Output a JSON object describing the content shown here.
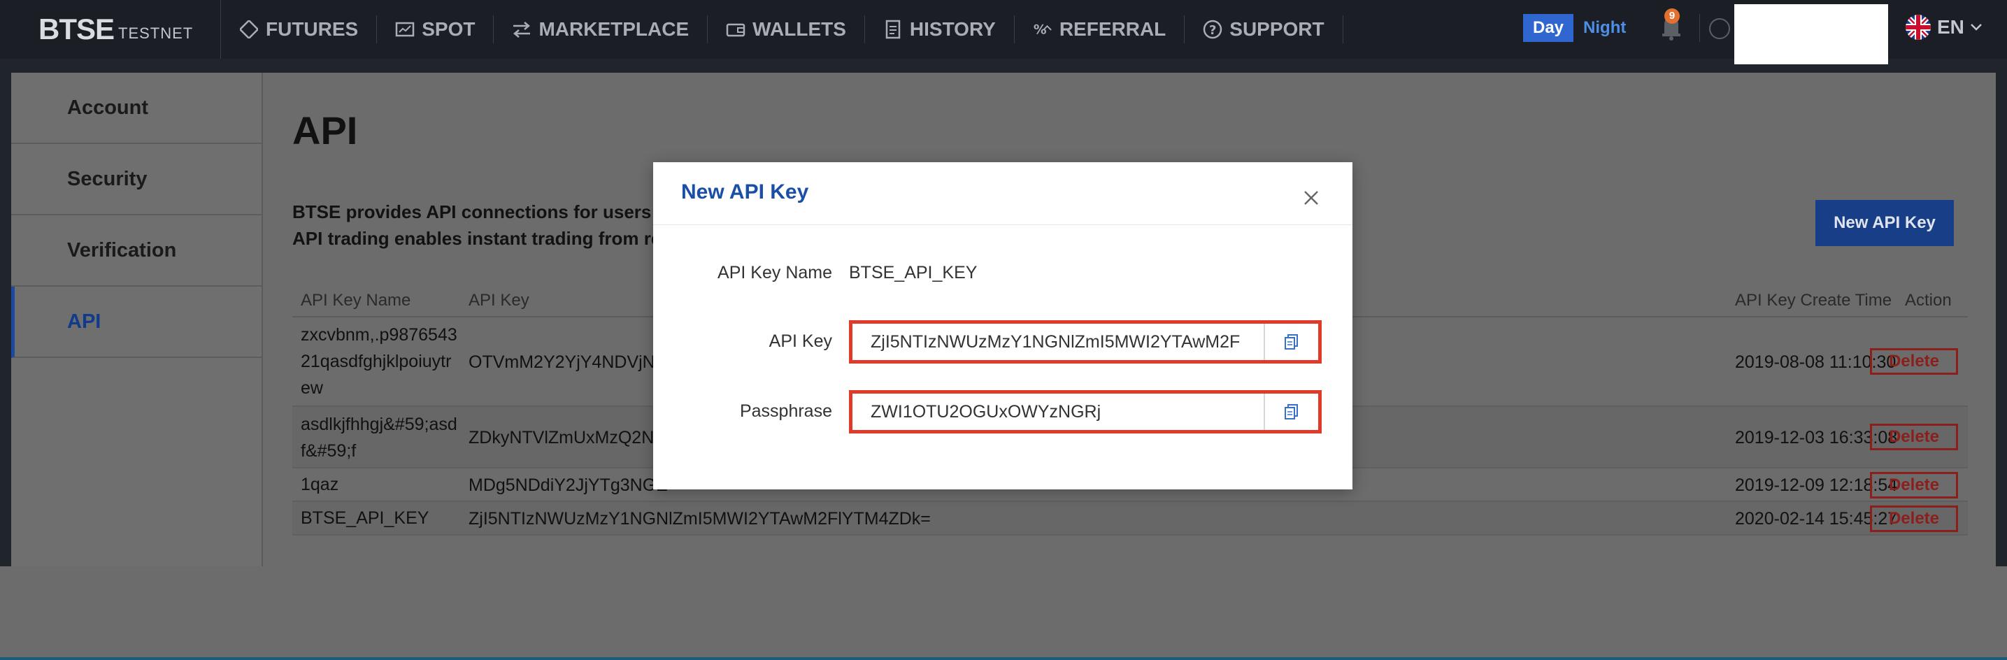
{
  "nav": {
    "brand": "BTSE",
    "network": "TESTNET",
    "items": [
      {
        "label": "FUTURES",
        "icon": "futures-icon"
      },
      {
        "label": "SPOT",
        "icon": "spot-icon"
      },
      {
        "label": "MARKETPLACE",
        "icon": "marketplace-icon"
      },
      {
        "label": "WALLETS",
        "icon": "wallet-icon"
      },
      {
        "label": "HISTORY",
        "icon": "history-icon"
      },
      {
        "label": "REFERRAL",
        "icon": "referral-icon"
      },
      {
        "label": "SUPPORT",
        "icon": "support-icon"
      }
    ],
    "theme_day": "Day",
    "theme_night": "Night",
    "notification_count": "9",
    "language": "EN"
  },
  "sidebar": {
    "items": [
      {
        "label": "Account"
      },
      {
        "label": "Security"
      },
      {
        "label": "Verification"
      },
      {
        "label": "API"
      }
    ]
  },
  "main": {
    "title": "API",
    "desc_line1": "BTSE provides API connections for users to a",
    "desc_line2": "API trading enables instant trading from real-",
    "new_key_button": "New API Key",
    "table": {
      "headers": {
        "name": "API Key Name",
        "key": "API Key",
        "created": "API Key Create Time",
        "action": "Action"
      },
      "rows": [
        {
          "name_lines": [
            "zxcvbnm,.p9876543",
            "21qasdfghjklpoiuytr",
            "ew"
          ],
          "key": "OTVmM2Y2YjY4NDVjND",
          "created": "2019-08-08 11:10:30",
          "action": "Delete"
        },
        {
          "name_lines": [
            "asdlkjfhhgj&#59;asd",
            "f&#59;f"
          ],
          "key": "ZDkyNTVlZmUxMzQ2NG",
          "created": "2019-12-03 16:33:08",
          "action": "Delete"
        },
        {
          "name_lines": [
            "1qaz"
          ],
          "key": "MDg5NDdiY2JjYTg3NGE",
          "created": "2019-12-09 12:18:54",
          "action": "Delete"
        },
        {
          "name_lines": [
            "BTSE_API_KEY"
          ],
          "key": "ZjI5NTIzNWUzMzY1NGNlZmI5MWI2YTAwM2FlYTM4ZDk=",
          "created": "2020-02-14 15:45:27",
          "action": "Delete"
        }
      ]
    }
  },
  "modal": {
    "title": "New API Key",
    "name_label": "API Key Name",
    "name_value": "BTSE_API_KEY",
    "key_label": "API Key",
    "key_value": "ZjI5NTIzNWUzMzY1NGNlZmI5MWI2YTAwM2F",
    "pass_label": "Passphrase",
    "pass_value": "ZWI1OTU2OGUxOWYzNGRj"
  },
  "colors": {
    "accent": "#1a4fa6",
    "highlight_border": "#e03a2a",
    "delete": "#8b1f1b"
  }
}
